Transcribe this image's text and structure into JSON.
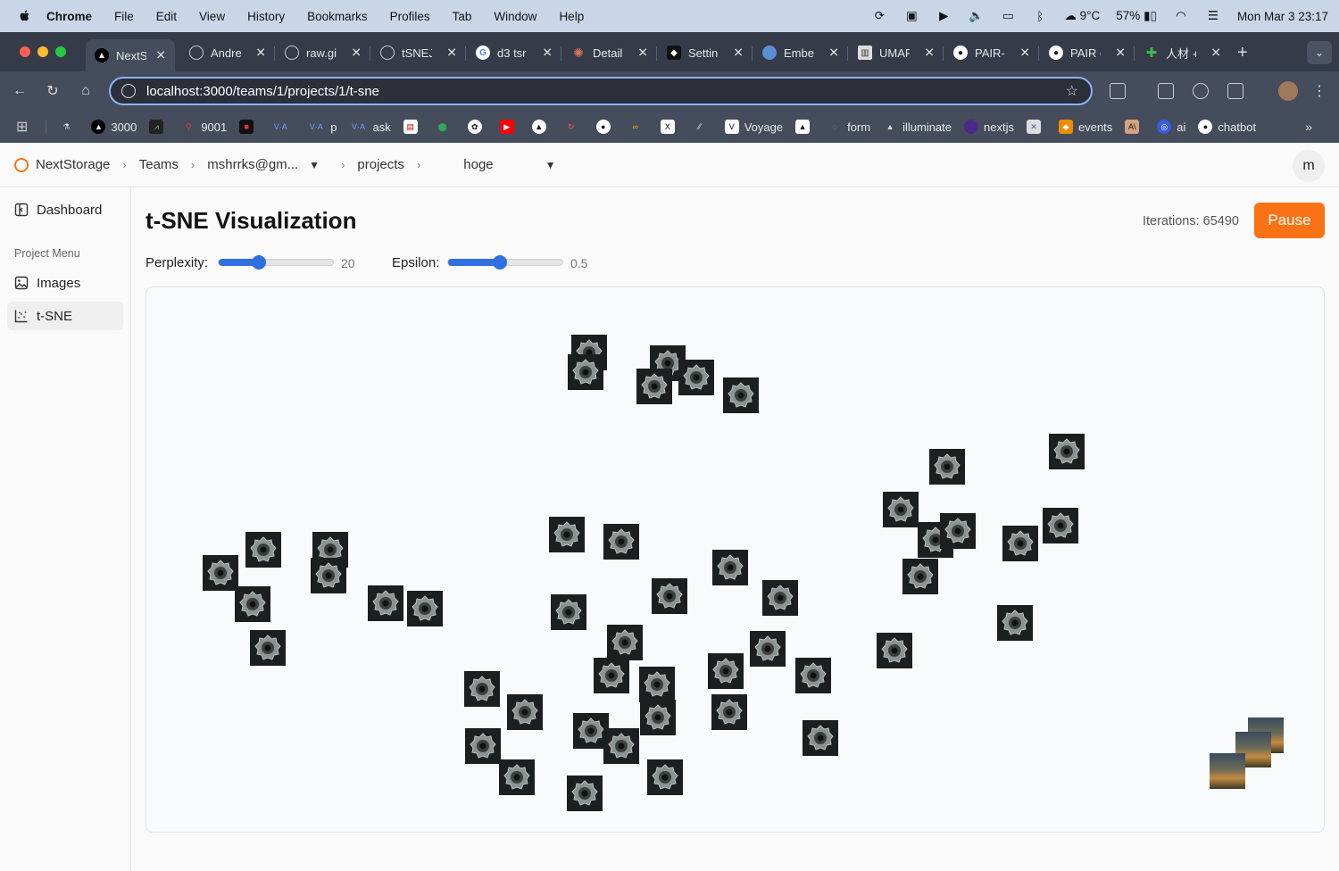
{
  "menubar": {
    "app": "Chrome",
    "items": [
      "File",
      "Edit",
      "View",
      "History",
      "Bookmarks",
      "Profiles",
      "Tab",
      "Window",
      "Help"
    ],
    "weather": "9°C",
    "battery": "57%",
    "datetime": "Mon Mar 3  23:17"
  },
  "browser": {
    "tabs": [
      {
        "title": "NextS",
        "icon": "vercel-icon"
      },
      {
        "title": "Andre",
        "icon": "globe-icon"
      },
      {
        "title": "raw.gi",
        "icon": "globe-icon"
      },
      {
        "title": "tSNEJ",
        "icon": "globe-icon"
      },
      {
        "title": "d3 tsr",
        "icon": "google-icon"
      },
      {
        "title": "Detail",
        "icon": "claude-icon"
      },
      {
        "title": "Settin",
        "icon": "settings-icon"
      },
      {
        "title": "Embe",
        "icon": "embed-icon"
      },
      {
        "title": "UMAP",
        "icon": "umap-icon"
      },
      {
        "title": "PAIR-",
        "icon": "github-icon"
      },
      {
        "title": "PAIR c",
        "icon": "github-icon"
      },
      {
        "title": "人材 +",
        "icon": "plus-icon"
      }
    ],
    "url": "localhost:3000/teams/1/projects/1/t-sne",
    "bookmarks": [
      {
        "label": "",
        "icon": "lab-icon"
      },
      {
        "label": "3000",
        "icon": "vercel-icon"
      },
      {
        "label": "",
        "icon": "chart-icon"
      },
      {
        "label": "9001",
        "icon": "runner-icon"
      },
      {
        "label": "",
        "icon": "dark-icon"
      },
      {
        "label": "",
        "icon": "va-icon"
      },
      {
        "label": "p",
        "icon": "va-icon"
      },
      {
        "label": "ask",
        "icon": "va-icon"
      },
      {
        "label": "",
        "icon": "news-icon"
      },
      {
        "label": "",
        "icon": "maps-icon"
      },
      {
        "label": "",
        "icon": "openai-icon"
      },
      {
        "label": "",
        "icon": "youtube-icon"
      },
      {
        "label": "",
        "icon": "vercel-icon"
      },
      {
        "label": "",
        "icon": "refresh-icon"
      },
      {
        "label": "",
        "icon": "github-icon"
      },
      {
        "label": "",
        "icon": "colab-icon"
      },
      {
        "label": "",
        "icon": "x-icon"
      },
      {
        "label": "",
        "icon": "slash-icon"
      },
      {
        "label": "Voyage",
        "icon": "v-icon"
      },
      {
        "label": "",
        "icon": "vercel-icon"
      },
      {
        "label": "form",
        "icon": "form-icon"
      },
      {
        "label": "illuminate",
        "icon": "vercel-icon"
      },
      {
        "label": "nextjs",
        "icon": "circle-icon"
      },
      {
        "label": "",
        "icon": "cross-icon"
      },
      {
        "label": "events",
        "icon": "box-icon"
      },
      {
        "label": "",
        "icon": "anthropic-icon"
      },
      {
        "label": "ai",
        "icon": "ai-icon"
      },
      {
        "label": "chatbot",
        "icon": "github-icon"
      }
    ]
  },
  "header": {
    "brand": "NextStorage",
    "breadcrumb": [
      "Teams",
      "mshrrks@gm...",
      "projects",
      "hoge"
    ]
  },
  "user": {
    "initial": "m"
  },
  "sidebar": {
    "dashboard": "Dashboard",
    "section": "Project Menu",
    "items": [
      "Images",
      "t-SNE"
    ]
  },
  "main": {
    "title": "t-SNE Visualization",
    "iterations": "Iterations: 65490",
    "pause": "Pause",
    "perplexity": {
      "label": "Perplexity:",
      "value": "20",
      "fraction": 0.35
    },
    "epsilon": {
      "label": "Epsilon:",
      "value": "0.5",
      "fraction": 0.45
    }
  },
  "colors": {
    "accent": "#f97316",
    "slider": "#2f6fe0"
  }
}
